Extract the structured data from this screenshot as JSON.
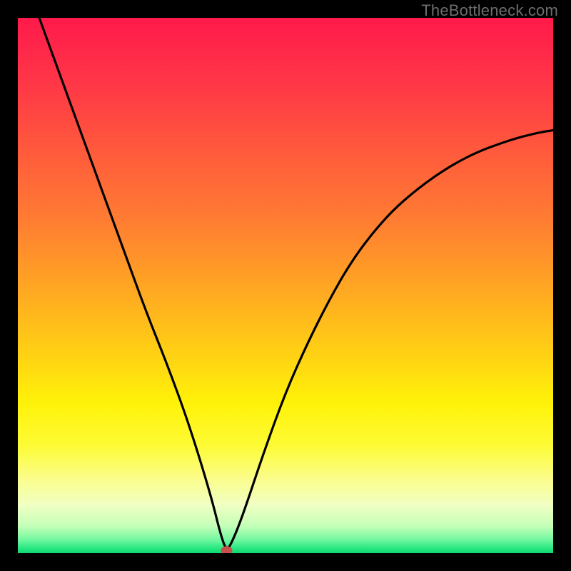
{
  "watermark": "TheBottleneck.com",
  "chart_data": {
    "type": "line",
    "title": "",
    "xlabel": "",
    "ylabel": "",
    "xlim": [
      0,
      100
    ],
    "ylim": [
      0,
      100
    ],
    "grid": false,
    "legend": false,
    "series": [
      {
        "name": "curve",
        "x": [
          4,
          8,
          12,
          16,
          20,
          24,
          28,
          32,
          36,
          38,
          39,
          40,
          42,
          46,
          50,
          54,
          58,
          62,
          66,
          70,
          74,
          78,
          82,
          86,
          90,
          94,
          98,
          100
        ],
        "y": [
          100,
          89,
          78,
          67,
          56,
          45,
          35,
          24,
          11,
          3,
          0.5,
          2,
          7,
          19,
          30,
          39,
          47,
          54,
          59.5,
          64,
          67.5,
          70.5,
          73,
          75,
          76.5,
          77.8,
          78.7,
          79
        ]
      }
    ],
    "marker": {
      "x": 39,
      "y": 0.5,
      "color": "#c94f4a"
    },
    "background_gradient": {
      "stops": [
        {
          "offset": 0.0,
          "color": "#ff1a4b"
        },
        {
          "offset": 0.12,
          "color": "#ff3647"
        },
        {
          "offset": 0.25,
          "color": "#ff5a3c"
        },
        {
          "offset": 0.38,
          "color": "#ff7d32"
        },
        {
          "offset": 0.5,
          "color": "#ffa523"
        },
        {
          "offset": 0.62,
          "color": "#ffce15"
        },
        {
          "offset": 0.72,
          "color": "#fff209"
        },
        {
          "offset": 0.8,
          "color": "#fdfb36"
        },
        {
          "offset": 0.86,
          "color": "#fbfd8a"
        },
        {
          "offset": 0.91,
          "color": "#f1ffc3"
        },
        {
          "offset": 0.95,
          "color": "#c3ffb8"
        },
        {
          "offset": 0.975,
          "color": "#71f8a0"
        },
        {
          "offset": 0.99,
          "color": "#2ce884"
        },
        {
          "offset": 1.0,
          "color": "#0fd66f"
        }
      ]
    }
  }
}
